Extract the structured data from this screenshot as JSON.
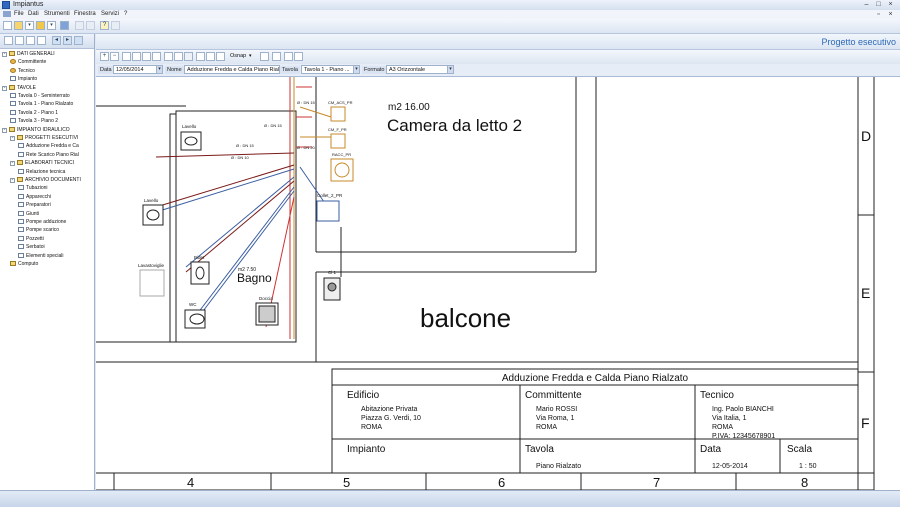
{
  "window": {
    "title": "Impiantus"
  },
  "menu": [
    "File",
    "Dati",
    "Strumenti",
    "Finestra",
    "Servizi",
    "?"
  ],
  "mode_label": "Progetto esecutivo",
  "fields": {
    "data_label": "Data",
    "data_value": "12/05/2014",
    "nome_label": "Nome",
    "nome_value": "Adduzione Fredda e Calda Piano Rialzato",
    "tavola_label": "Tavola",
    "tavola_value": "Tavola 1 - Piano ...",
    "formato_label": "Formato",
    "formato_value": "A3 Orizzontale"
  },
  "toolbar": {
    "osnap_label": "Osnap"
  },
  "tree": [
    {
      "label": "DATI GENERALI",
      "level": 0,
      "kind": "folder",
      "expander": "-"
    },
    {
      "label": "Committente",
      "level": 1,
      "kind": "pers"
    },
    {
      "label": "Tecnico",
      "level": 1,
      "kind": "pers"
    },
    {
      "label": "Impianto",
      "level": 1,
      "kind": "doc"
    },
    {
      "label": "TAVOLE",
      "level": 0,
      "kind": "folder",
      "expander": "-"
    },
    {
      "label": "Tavola 0 - Seminterrato",
      "level": 1,
      "kind": "doc"
    },
    {
      "label": "Tavola 1 - Piano Rialzato",
      "level": 1,
      "kind": "doc"
    },
    {
      "label": "Tavola 2 - Piano 1",
      "level": 1,
      "kind": "doc"
    },
    {
      "label": "Tavola 3 - Piano 2",
      "level": 1,
      "kind": "doc"
    },
    {
      "label": "IMPIANTO IDRAULICO",
      "level": 0,
      "kind": "folder",
      "expander": "-"
    },
    {
      "label": "PROGETTI ESECUTIVI",
      "level": 1,
      "kind": "folder",
      "expander": "-"
    },
    {
      "label": "Adduzione Fredda e Ca",
      "level": 2,
      "kind": "doc"
    },
    {
      "label": "Rete Scarico Piano Rial",
      "level": 2,
      "kind": "doc"
    },
    {
      "label": "ELABORATI TECNICI",
      "level": 1,
      "kind": "folder",
      "expander": "-"
    },
    {
      "label": "Relazione tecnica",
      "level": 2,
      "kind": "doc"
    },
    {
      "label": "ARCHIVIO DOCUMENTI",
      "level": 1,
      "kind": "folder",
      "expander": "-"
    },
    {
      "label": "Tubazioni",
      "level": 2,
      "kind": "doc"
    },
    {
      "label": "Apparecchi",
      "level": 2,
      "kind": "doc"
    },
    {
      "label": "Preparatori",
      "level": 2,
      "kind": "doc"
    },
    {
      "label": "Giunti",
      "level": 2,
      "kind": "doc"
    },
    {
      "label": "Pompe adduzione",
      "level": 2,
      "kind": "doc"
    },
    {
      "label": "Pompe scarico",
      "level": 2,
      "kind": "doc"
    },
    {
      "label": "Pozzetti",
      "level": 2,
      "kind": "doc"
    },
    {
      "label": "Serbatoi",
      "level": 2,
      "kind": "doc"
    },
    {
      "label": "Elementi speciali",
      "level": 2,
      "kind": "doc"
    },
    {
      "label": "Computo",
      "level": 1,
      "kind": "folder"
    }
  ],
  "drawing": {
    "room1_area": "m2 16.00",
    "room1_name": "Camera da letto 2",
    "room2_area": "m2 7.50",
    "room2_name": "Bagno",
    "room3_name": "balcone",
    "fixture_lavello": "Lavello",
    "fixture_lavabo": "Lavello",
    "fixture_lavastoviglie": "Lavastoviglie",
    "fixture_bidet": "Bidet",
    "fixture_wc": "WC",
    "fixture_doccia": "Doccia",
    "collettore": "Collet_2_PR",
    "c1": "Cl 1",
    "tag_acs": "CM_ACS_PR",
    "tag_af": "CM_F_PR",
    "tag_racc": "RACC_PR",
    "pipe_dn15": "Ø : DN 15",
    "pipe_dn10": "Ø : DN 10",
    "pipe_dn20": "Ø : DN 20",
    "grid_right": [
      "D",
      "E",
      "F"
    ],
    "grid_bottom": [
      "4",
      "5",
      "6",
      "7",
      "8"
    ]
  },
  "cartiglio": {
    "title": "Adduzione Fredda e Calda Piano Rialzato",
    "edificio_h": "Edificio",
    "edificio_lines": [
      "Abitazione Privata",
      "Piazza G. Verdi, 10",
      "ROMA"
    ],
    "committente_h": "Committente",
    "committente_lines": [
      "Mario ROSSI",
      "Via Roma, 1",
      "ROMA"
    ],
    "tecnico_h": "Tecnico",
    "tecnico_lines": [
      "Ing. Paolo BIANCHI",
      "Via Italia, 1",
      "ROMA",
      "P.IVA: 12345678901"
    ],
    "impianto_h": "Impianto",
    "tavola_h": "Tavola",
    "tavola_v": "Piano Rialzato",
    "data_h": "Data",
    "data_v": "12-05-2014",
    "scala_h": "Scala",
    "scala_v": "1 : 50"
  }
}
